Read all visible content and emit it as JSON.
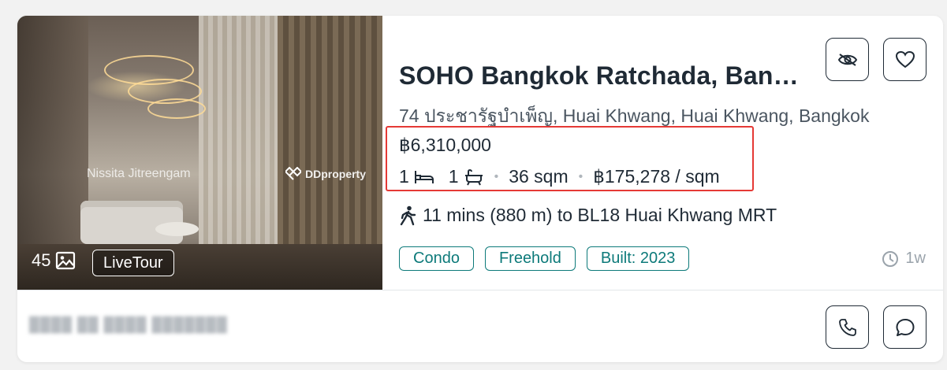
{
  "listing": {
    "title": "SOHO Bangkok Ratchada, Ban…",
    "address": "74 ประชารัฐบำเพ็ญ, Huai Khwang, Huai Khwang, Bangkok",
    "price": "฿6,310,000",
    "bedrooms": "1",
    "bathrooms": "1",
    "area": "36 sqm",
    "price_per_sqm": "฿175,278 / sqm",
    "transit": "11 mins (880 m) to BL18 Huai Khwang MRT",
    "tags": [
      "Condo",
      "Freehold",
      "Built: 2023"
    ],
    "posted_ago": "1w"
  },
  "photo": {
    "count": "45",
    "live_tour_label": "LiveTour",
    "watermark_name": "Nissita Jitreengam",
    "watermark_brand": "DDproperty"
  },
  "agent": {
    "name": "████ ██ ████ ███████"
  },
  "icons": {
    "hide": "eye-slash-icon",
    "favorite": "heart-icon",
    "call": "phone-icon",
    "chat": "chat-bubble-icon",
    "photo": "image-icon",
    "bed": "bed-icon",
    "bath": "bathtub-icon",
    "walk": "walking-person-icon",
    "clock": "clock-icon"
  },
  "colors": {
    "tag_accent": "#0d7a7a",
    "highlight_border": "#e53935",
    "text_primary": "#1f2a35",
    "text_muted": "#9aa3ab"
  }
}
